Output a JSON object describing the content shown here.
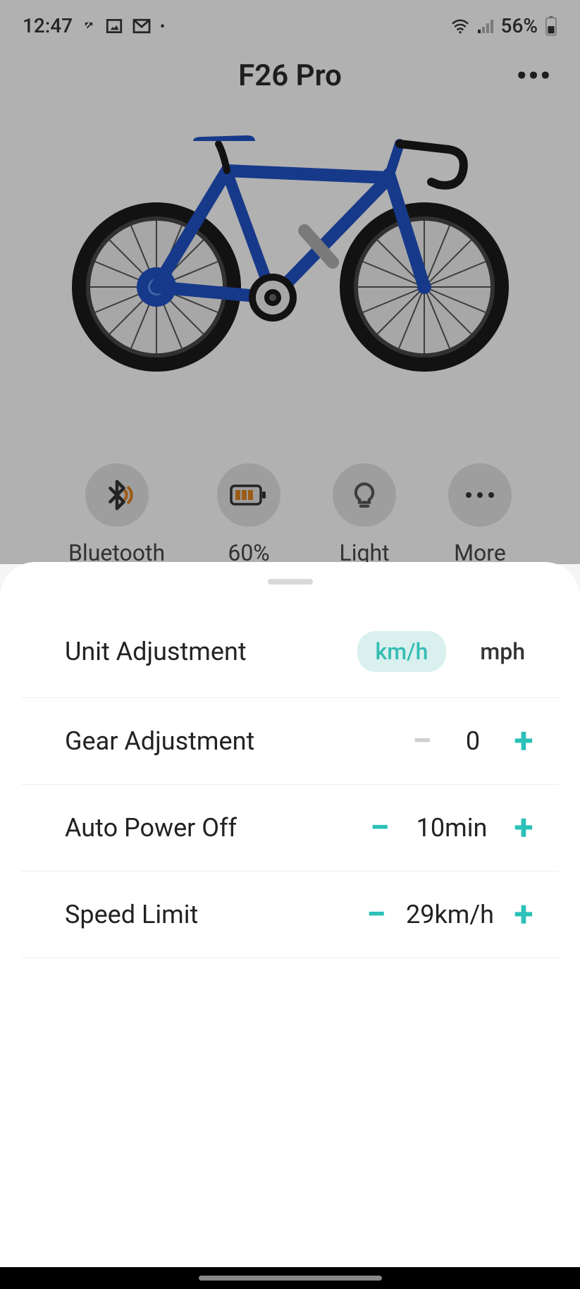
{
  "statusBar": {
    "time": "12:47",
    "batteryPercent": "56%"
  },
  "header": {
    "title": "F26 Pro"
  },
  "quickActions": {
    "bluetooth": {
      "label": "Bluetooth"
    },
    "battery": {
      "label": "60%"
    },
    "light": {
      "label": "Light"
    },
    "more": {
      "label": "More"
    }
  },
  "settings": {
    "unitAdjustment": {
      "label": "Unit Adjustment",
      "option1": "km/h",
      "option2": "mph",
      "selected": "km/h"
    },
    "gearAdjustment": {
      "label": "Gear Adjustment",
      "value": "0"
    },
    "autoPowerOff": {
      "label": "Auto Power Off",
      "value": "10min"
    },
    "speedLimit": {
      "label": "Speed Limit",
      "value": "29km/h"
    }
  },
  "colors": {
    "accent": "#2bc1b9",
    "bikeFrame": "#2050c0"
  }
}
